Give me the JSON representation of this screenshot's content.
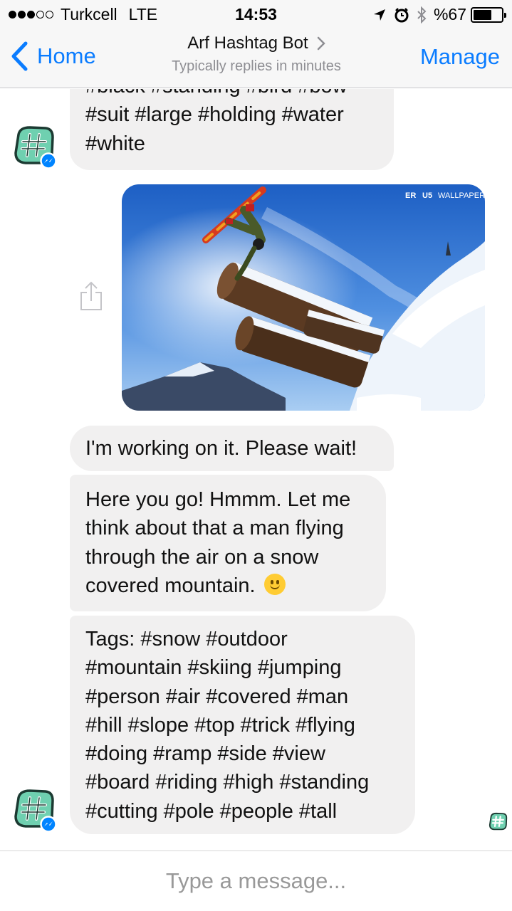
{
  "status_bar": {
    "signal_bars_filled": 3,
    "signal_bars_total": 5,
    "carrier": "Turkcell",
    "network": "LTE",
    "time": "14:53",
    "battery": "%67",
    "battery_level": 0.67,
    "icons": [
      "location-arrow-icon",
      "alarm-clock-icon",
      "bluetooth-icon"
    ]
  },
  "nav": {
    "back_label": "Home",
    "title": "Arf Hashtag Bot",
    "subtitle": "Typically replies in minutes",
    "manage_label": "Manage"
  },
  "messages": {
    "tags_top": [
      "#black #standing #bird #bow",
      "#suit #large #holding #water",
      "#white"
    ],
    "photo": {
      "alt_logo_text": "WALLPAPER"
    },
    "working": "I'm working on it. Please wait!",
    "here_lines": [
      "Here you go! Hmmm. Let me",
      "think about that a man flying",
      "through the air on a snow",
      "covered mountain."
    ],
    "tags_lines": [
      "Tags: #snow #outdoor",
      "#mountain #skiing #jumping",
      "#person #air #covered #man",
      "#hill #slope #top #trick #flying",
      "#doing #ramp #side #view",
      "#board #riding #high #standing",
      "#cutting #pole #people #tall"
    ]
  },
  "composer": {
    "placeholder": "Type a message..."
  },
  "colors": {
    "accent": "#0a7cff",
    "bubble": "#f1f0f0",
    "avatar_green": "#6fd0b0",
    "messenger_badge": "#0084ff"
  }
}
